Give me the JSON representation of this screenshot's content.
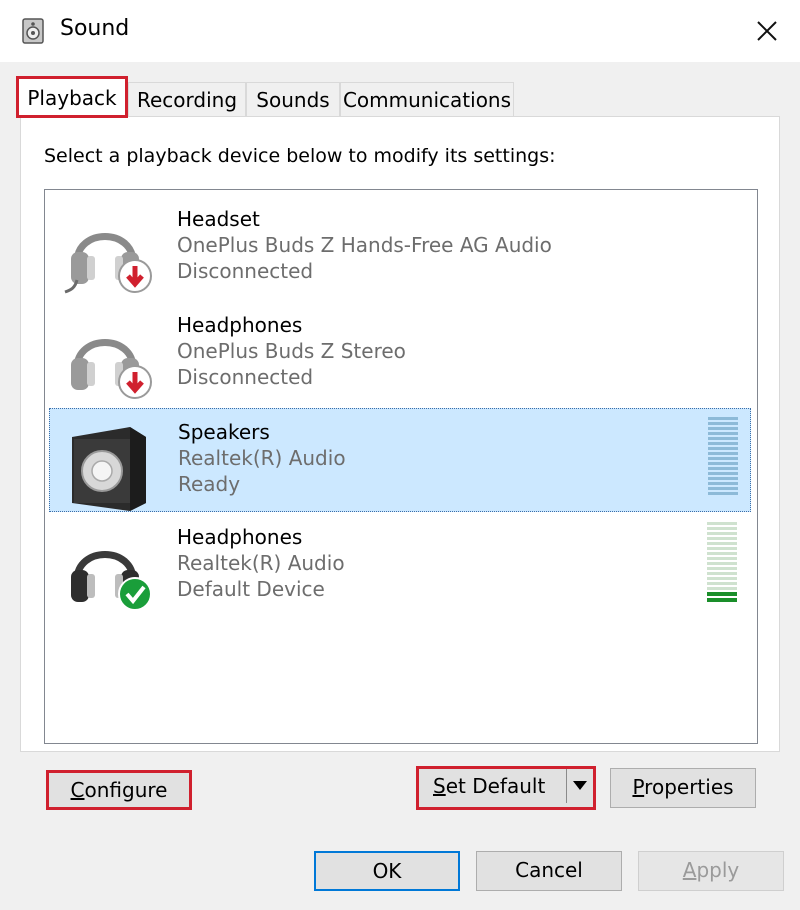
{
  "window": {
    "title": "Sound"
  },
  "tabs": [
    {
      "label": "Playback",
      "active": true
    },
    {
      "label": "Recording",
      "active": false
    },
    {
      "label": "Sounds",
      "active": false
    },
    {
      "label": "Communications",
      "active": false
    }
  ],
  "instruction": "Select a playback device below to modify its settings:",
  "devices": [
    {
      "name": "Headset",
      "description": "OnePlus Buds Z Hands-Free AG Audio",
      "status": "Disconnected",
      "icon": "headset-disconnected-icon",
      "selected": false
    },
    {
      "name": "Headphones",
      "description": "OnePlus Buds Z Stereo",
      "status": "Disconnected",
      "icon": "headphones-disconnected-icon",
      "selected": false
    },
    {
      "name": "Speakers",
      "description": "Realtek(R) Audio",
      "status": "Ready",
      "icon": "speaker-icon",
      "selected": true
    },
    {
      "name": "Headphones",
      "description": "Realtek(R) Audio",
      "status": "Default Device",
      "icon": "headphones-default-icon",
      "selected": false
    }
  ],
  "buttons": {
    "configure": {
      "underline": "C",
      "rest": "onfigure"
    },
    "set_default": {
      "underline": "S",
      "rest": "et Default"
    },
    "properties": {
      "underline": "P",
      "rest": "roperties"
    },
    "ok": "OK",
    "cancel": "Cancel",
    "apply": {
      "underline": "A",
      "rest": "pply"
    }
  },
  "colors": {
    "highlight": "#d0202e",
    "selection": "#cce8ff",
    "accent": "#0078d7",
    "level": "#1a8e2a"
  }
}
